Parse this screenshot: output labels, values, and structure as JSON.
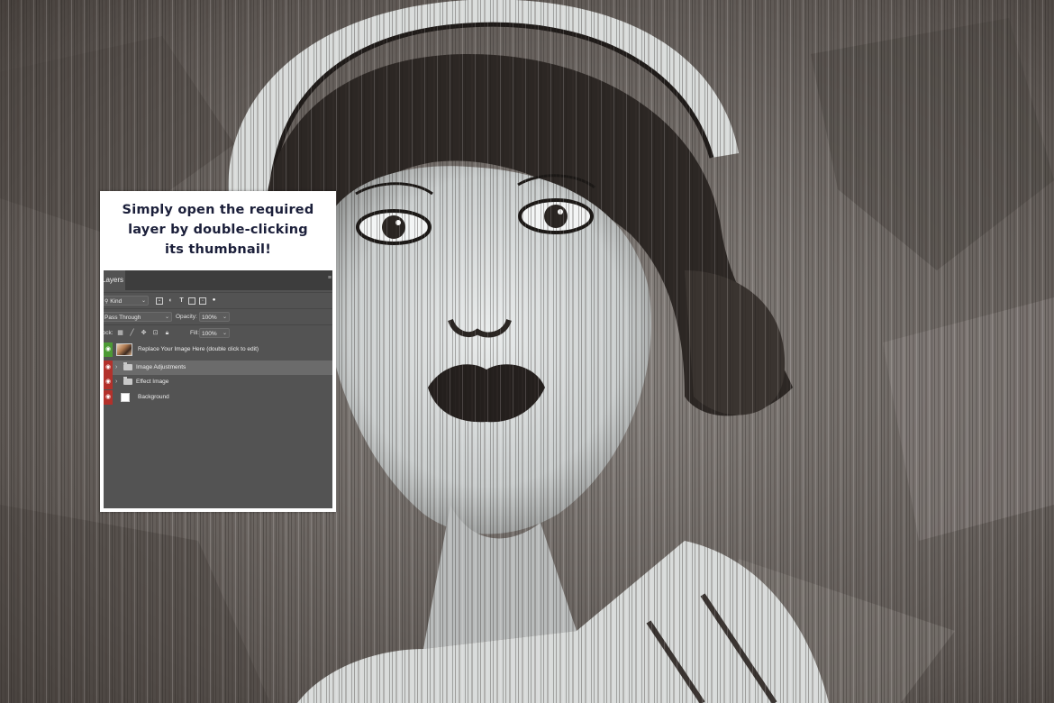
{
  "caption": {
    "lines": [
      "Simply open the required",
      "layer by double-clicking",
      "its thumbnail!"
    ]
  },
  "layers_panel": {
    "tab_label": "Layers",
    "filter": {
      "kind_label": "Kind"
    },
    "blend_mode": "Pass Through",
    "opacity_label": "Opacity:",
    "opacity_value": "100%",
    "lock_label": "Lock:",
    "fill_label": "Fill:",
    "fill_value": "100%",
    "layers": [
      {
        "name": "Replace Your Image Here (double click to edit)",
        "visible": true,
        "type": "smart-object",
        "selected": false
      },
      {
        "name": "Image Adjustments",
        "visible": true,
        "type": "group",
        "selected": true
      },
      {
        "name": "Effect Image",
        "visible": true,
        "type": "group",
        "selected": false
      },
      {
        "name": "Background",
        "visible": true,
        "type": "fill",
        "selected": false
      }
    ]
  },
  "colors": {
    "caption_text": "#1b1f3a",
    "panel_bg": "#535353",
    "visibility_highlight_green": "#4c9a35",
    "visibility_highlight_red": "#b3312b"
  }
}
